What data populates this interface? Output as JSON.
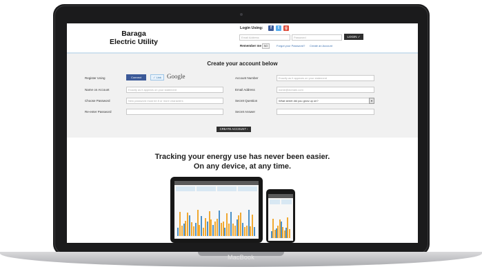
{
  "header": {
    "logo_line1": "Baraga",
    "logo_line2": "Electric Utility",
    "login_using": "Login Using:",
    "email_placeholder": "Email Address",
    "password_placeholder": "Password",
    "login_button": "LOGIN",
    "remember_me": "Remember me",
    "remember_value": "NO",
    "forgot_link": "Forgot your Password?",
    "create_link": "Create an Account"
  },
  "form": {
    "title": "Create your account below",
    "register_using": "Register Using",
    "fb_connect": "Connect",
    "tw_link": "Link",
    "google": "Google",
    "fields": {
      "name": {
        "label": "Name on Account",
        "placeholder": "Exactly as it appears on your statement"
      },
      "password": {
        "label": "Choose Password",
        "placeholder": "New password must be 8 or more characters"
      },
      "reenter": {
        "label": "Re-enter Password",
        "placeholder": ""
      },
      "account_number": {
        "label": "Account Number",
        "placeholder": "Exactly as it appears on your statement"
      },
      "email": {
        "label": "Email Address",
        "placeholder": "name@domain.com"
      },
      "secret_question": {
        "label": "Secret Question",
        "value": "What street did you grow up on?"
      },
      "secret_answer": {
        "label": "Secret Answer",
        "placeholder": ""
      }
    },
    "create_button": "CREATE ACCOUNT"
  },
  "promo": {
    "headline_line1": "Tracking your energy use has never been easier.",
    "headline_line2": "On any device, at any time."
  },
  "device": {
    "brand": "MacBook"
  },
  "colors": {
    "facebook": "#3b5998",
    "twitter": "#55acee",
    "bar_orange": "#f0a830",
    "bar_blue": "#4a90c8"
  }
}
